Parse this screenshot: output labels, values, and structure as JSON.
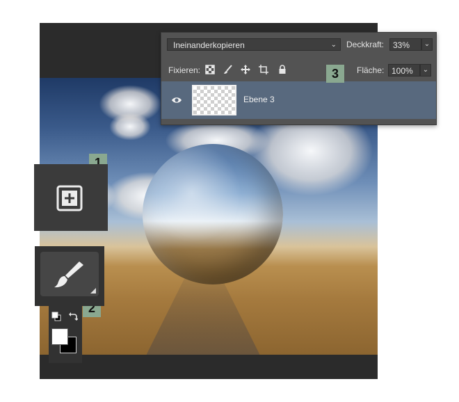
{
  "layers_panel": {
    "blend_mode": "Ineinanderkopieren",
    "opacity_label": "Deckkraft:",
    "opacity_value": "33%",
    "lock_label": "Fixieren:",
    "fill_label": "Fläche:",
    "fill_value": "100%",
    "layer_name": "Ebene 3"
  },
  "badges": {
    "one": "1",
    "two": "2",
    "three": "3"
  },
  "icons": {
    "lock_transparent": "checker-lock-icon",
    "lock_paint": "brush-lock-icon",
    "lock_move": "move-lock-icon",
    "lock_artboard": "artboard-lock-icon",
    "lock_all": "padlock-icon",
    "visibility": "eye-icon",
    "zoom_tool": "plus-square-icon",
    "brush_tool": "brush-icon",
    "default_colors": "default-colors-icon",
    "swap_colors": "swap-arrow-icon"
  },
  "colors": {
    "panel_bg": "#535353",
    "selected_layer": "#58697e",
    "badge": "#8aa890",
    "foreground_color": "#ffffff",
    "background_color": "#000000"
  }
}
